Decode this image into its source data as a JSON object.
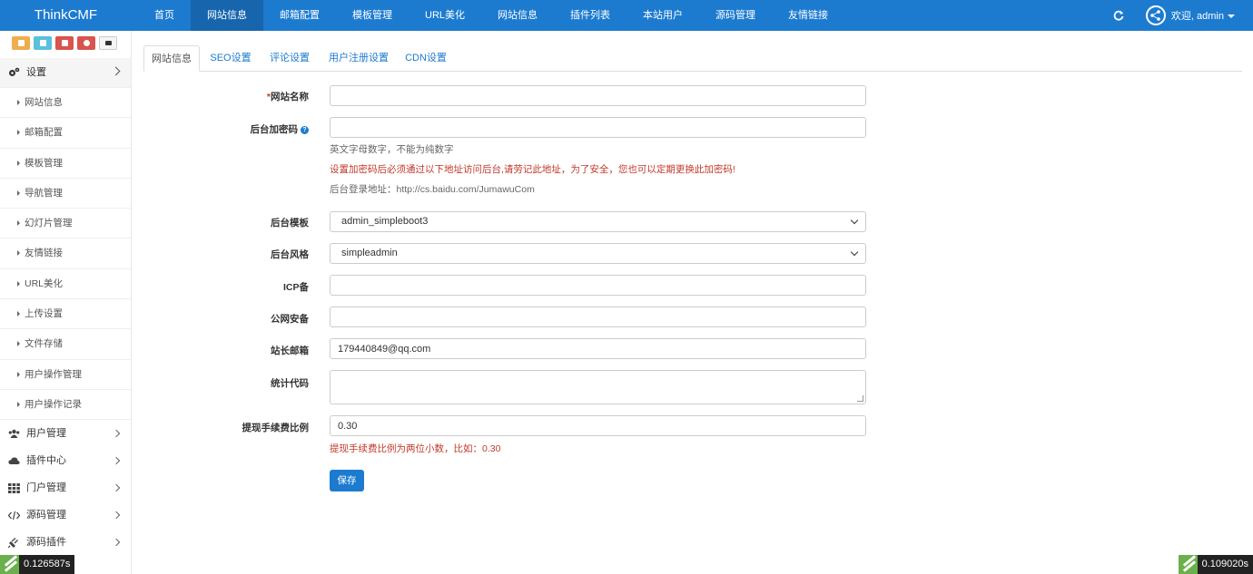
{
  "brand": "ThinkCMF",
  "nav": [
    "首页",
    "网站信息",
    "邮箱配置",
    "模板管理",
    "URL美化",
    "网站信息",
    "插件列表",
    "本站用户",
    "源码管理",
    "友情链接"
  ],
  "user": {
    "welcome": "欢迎, admin"
  },
  "quick_buttons": [
    {
      "icon": "home-icon",
      "color": "#f0ad4e"
    },
    {
      "icon": "file-icon",
      "color": "#5bc0de"
    },
    {
      "icon": "trash-icon",
      "color": "#d9534f"
    },
    {
      "icon": "recycle-icon",
      "color": "#d9534f"
    },
    {
      "icon": "list-icon",
      "color": "#f5f5f5"
    }
  ],
  "sidebar": {
    "settings": {
      "label": "设置",
      "icon": "gears-icon"
    },
    "sub_items": [
      "网站信息",
      "邮箱配置",
      "模板管理",
      "导航管理",
      "幻灯片管理",
      "友情链接",
      "URL美化",
      "上传设置",
      "文件存储",
      "用户操作管理",
      "用户操作记录"
    ],
    "groups": [
      {
        "label": "用户管理",
        "icon": "users-icon"
      },
      {
        "label": "插件中心",
        "icon": "cloud-icon"
      },
      {
        "label": "门户管理",
        "icon": "grid-icon"
      },
      {
        "label": "源码管理",
        "icon": "code-icon"
      },
      {
        "label": "源码插件",
        "icon": "plug-icon"
      }
    ]
  },
  "tabs": [
    "网站信息",
    "SEO设置",
    "评论设置",
    "用户注册设置",
    "CDN设置"
  ],
  "form": {
    "site_name": {
      "label": "网站名称",
      "required": "*",
      "value": ""
    },
    "admin_password": {
      "label": "后台加密码",
      "value": ""
    },
    "password_hint": "英文字母数字，不能为纯数字",
    "password_warning": "设置加密码后必须通过以下地址访问后台,请劳记此地址，为了安全，您也可以定期更换此加密码!",
    "login_url": "后台登录地址：http://cs.baidu.com/JumawuCom",
    "admin_theme": {
      "label": "后台模板",
      "value": "admin_simpleboot3"
    },
    "admin_style": {
      "label": "后台风格",
      "value": "simpleadmin"
    },
    "icp": {
      "label": "ICP备",
      "value": ""
    },
    "police": {
      "label": "公网安备",
      "value": ""
    },
    "email": {
      "label": "站长邮箱",
      "value": "179440849@qq.com"
    },
    "stats_code": {
      "label": "统计代码",
      "value": ""
    },
    "fee_ratio": {
      "label": "提现手续费比例",
      "value": "0.30"
    },
    "fee_hint": "提现手续费比例为两位小数，比如：0.30",
    "save": "保存"
  },
  "timers": {
    "left": "0.126587s",
    "right": "0.109020s"
  },
  "colors": {
    "topbar": "#1d7bcf",
    "warning": "#c0392b",
    "primary": "#1d7bcf"
  }
}
